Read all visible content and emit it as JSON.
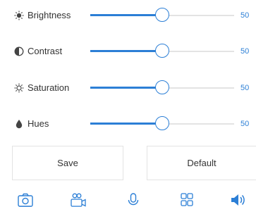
{
  "colors": {
    "accent": "#2c7fd6",
    "track": "#e3e3e3",
    "text": "#333333"
  },
  "sliders": [
    {
      "label": "Brightness",
      "value": "50",
      "level": 0.5,
      "icon": "sun-icon"
    },
    {
      "label": "Contrast",
      "value": "50",
      "level": 0.5,
      "icon": "contrast-icon"
    },
    {
      "label": "Saturation",
      "value": "50",
      "level": 0.5,
      "icon": "saturation-icon"
    },
    {
      "label": "Hues",
      "value": "50",
      "level": 0.5,
      "icon": "droplet-icon"
    }
  ],
  "buttons": {
    "save": "Save",
    "default": "Default"
  },
  "bottom_bar": [
    "camera-icon",
    "video-call-icon",
    "microphone-icon",
    "grid-icon",
    "speaker-icon"
  ]
}
